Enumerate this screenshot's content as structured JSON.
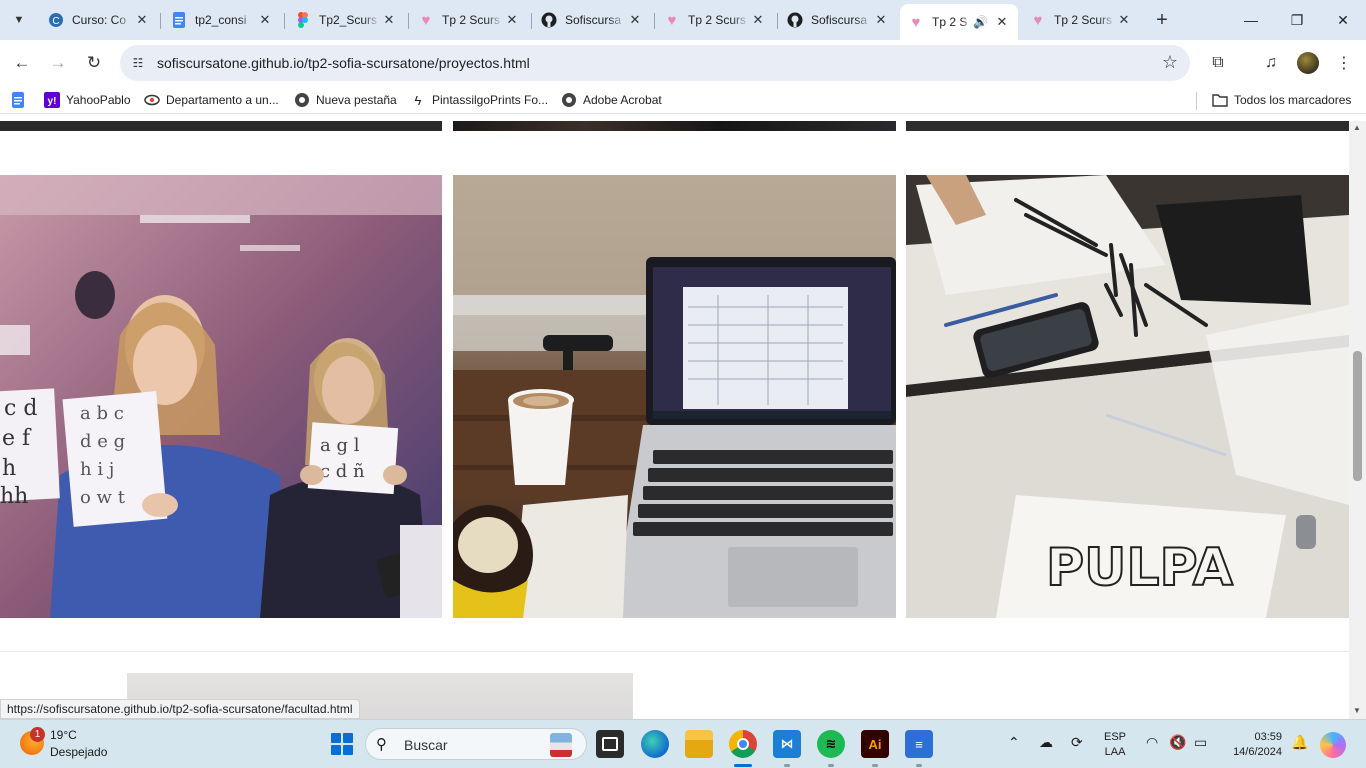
{
  "browser": {
    "tabs": [
      {
        "title": "Curso: Co",
        "icon": "course-icon"
      },
      {
        "title": "tp2_consi",
        "icon": "docs-icon"
      },
      {
        "title": "Tp2_Scurs",
        "icon": "figma-icon"
      },
      {
        "title": "Tp 2 Scurs",
        "icon": "heart-icon"
      },
      {
        "title": "Sofiscursa",
        "icon": "github-icon"
      },
      {
        "title": "Tp 2 Scurs",
        "icon": "heart-icon"
      },
      {
        "title": "Sofiscursa",
        "icon": "github-icon"
      },
      {
        "title": "Tp 2 S",
        "icon": "heart-icon",
        "active": true,
        "audio": true
      },
      {
        "title": "Tp 2 Scurs",
        "icon": "heart-icon"
      }
    ],
    "url": "sofiscursatone.github.io/tp2-sofia-scursatone/proyectos.html",
    "bookmarks": [
      {
        "label": "",
        "icon": "docs-icon"
      },
      {
        "label": "YahooPablo",
        "icon": "yahoo-icon"
      },
      {
        "label": "Departamento a un...",
        "icon": "eye-icon"
      },
      {
        "label": "Nueva pestaña",
        "icon": "globe-icon"
      },
      {
        "label": "PintassilgoPrints Fo...",
        "icon": "bolt-icon"
      },
      {
        "label": "Adobe Acrobat",
        "icon": "globe-icon"
      }
    ],
    "all_bookmarks_label": "Todos los marcadores",
    "status_url": "https://sofiscursatone.github.io/tp2-sofia-scursatone/facultad.html"
  },
  "page": {
    "photos": [
      {
        "name": "photo-students-alphabet",
        "alt": "students holding lettering sheets"
      },
      {
        "name": "photo-laptop-coffee",
        "alt": "laptop with coffee"
      },
      {
        "name": "photo-drawing-desk",
        "alt": "drawing desk with PULPA lettering"
      }
    ],
    "photo_text": "PULPA"
  },
  "taskbar": {
    "weather_temp": "19°C",
    "weather_condition": "Despejado",
    "weather_badge": "1",
    "search_placeholder": "Buscar",
    "lang_top": "ESP",
    "lang_bottom": "LAA",
    "time": "03:59",
    "date": "14/6/2024"
  },
  "colors": {
    "tabstrip": "#dee8f4",
    "omnibox": "#e9eef6",
    "taskbar": "#d6e6ee",
    "accent": "#0a6cd6"
  }
}
